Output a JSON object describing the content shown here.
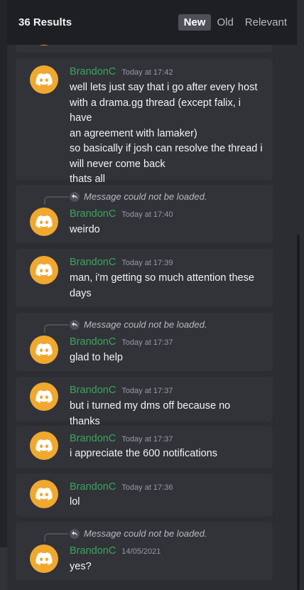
{
  "header": {
    "results_label": "36 Results",
    "sort_options": [
      "New",
      "Old",
      "Relevant"
    ],
    "active_sort": "New"
  },
  "messages": [
    {
      "user": "BrandonC",
      "time": "Today at 17:42",
      "lines": [
        "well lets just say that i go after every host",
        "with a drama.gg thread (except falix, i have",
        "an agreement with lamaker)",
        "so basically if josh can resolve the thread i",
        "will never come back",
        "thats all"
      ]
    },
    {
      "reply": "Message could not be loaded.",
      "user": "BrandonC",
      "time": "Today at 17:40",
      "lines": [
        "weirdo"
      ]
    },
    {
      "user": "BrandonC",
      "time": "Today at 17:39",
      "lines": [
        "man, i'm getting so much attention these",
        "days"
      ]
    },
    {
      "reply": "Message could not be loaded.",
      "user": "BrandonC",
      "time": "Today at 17:37",
      "lines": [
        "glad to help"
      ]
    },
    {
      "user": "BrandonC",
      "time": "Today at 17:37",
      "lines": [
        "but i turned my dms off because no thanks"
      ]
    },
    {
      "user": "BrandonC",
      "time": "Today at 17:37",
      "lines": [
        "i appreciate the 600 notifications"
      ]
    },
    {
      "user": "BrandonC",
      "time": "Today at 17:36",
      "lines": [
        "lol"
      ]
    },
    {
      "reply": "Message could not be loaded.",
      "user": "BrandonC",
      "time": "14/05/2021",
      "lines": [
        "yes?"
      ]
    }
  ],
  "colors": {
    "username": "#3ba55c",
    "avatar": "#f0a82e"
  }
}
